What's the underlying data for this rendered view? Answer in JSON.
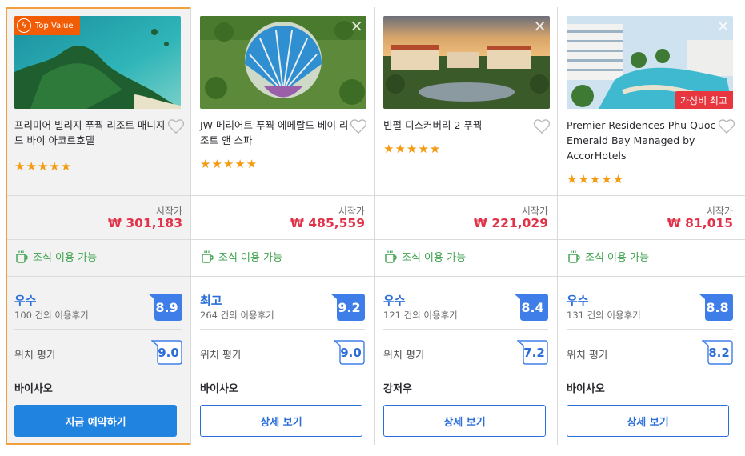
{
  "common": {
    "price_label": "시작가",
    "breakfast_label": "조식 이용 가능",
    "location_label": "위치 평가",
    "close_glyph": "×"
  },
  "hotels": [
    {
      "badge": "Top Value",
      "name": "프리미어 빌리지 푸꿕 리조트 매니지드 바이 아코르호텔",
      "stars": "★★★★★",
      "price": "₩ 301,183",
      "rating_word": "우수",
      "reviews": "100 건의 이용후기",
      "score": "8.9",
      "location_score": "9.0",
      "area": "바이사오",
      "button": "지금 예약하기"
    },
    {
      "name": "JW 메리어트 푸꿕 에메랄드 베이 리조트 앤 스파",
      "stars": "★★★★★",
      "price": "₩ 485,559",
      "rating_word": "최고",
      "reviews": "264 건의 이용후기",
      "score": "9.2",
      "location_score": "9.0",
      "area": "바이사오",
      "button": "상세 보기"
    },
    {
      "name": "빈펄 디스커버리 2 푸꿕",
      "stars": "★★★★★",
      "price": "₩ 221,029",
      "rating_word": "우수",
      "reviews": "121 건의 이용후기",
      "score": "8.4",
      "location_score": "7.2",
      "area": "강저우",
      "button": "상세 보기"
    },
    {
      "badge_value": "가성비 최고",
      "name": "Premier Residences Phu Quoc Emerald Bay Managed by AccorHotels",
      "stars": "★★★★★",
      "price": "₩ 81,015",
      "rating_word": "우수",
      "reviews": "131 건의 이용후기",
      "score": "8.8",
      "location_score": "8.2",
      "area": "바이사오",
      "button": "상세 보기"
    }
  ],
  "colors": {
    "accent_blue": "#2c6ed8",
    "price_red": "#e0334a",
    "breakfast_green": "#3fa24f",
    "star_orange": "#f39c12",
    "selected_border": "#f2a03d",
    "top_value_badge": "#f25c05",
    "best_value_badge": "#e8363f"
  },
  "icons": [
    "top-value-icon",
    "close-icon",
    "heart-icon",
    "star-icon",
    "coffee-cup-icon",
    "score-badge-icon"
  ]
}
